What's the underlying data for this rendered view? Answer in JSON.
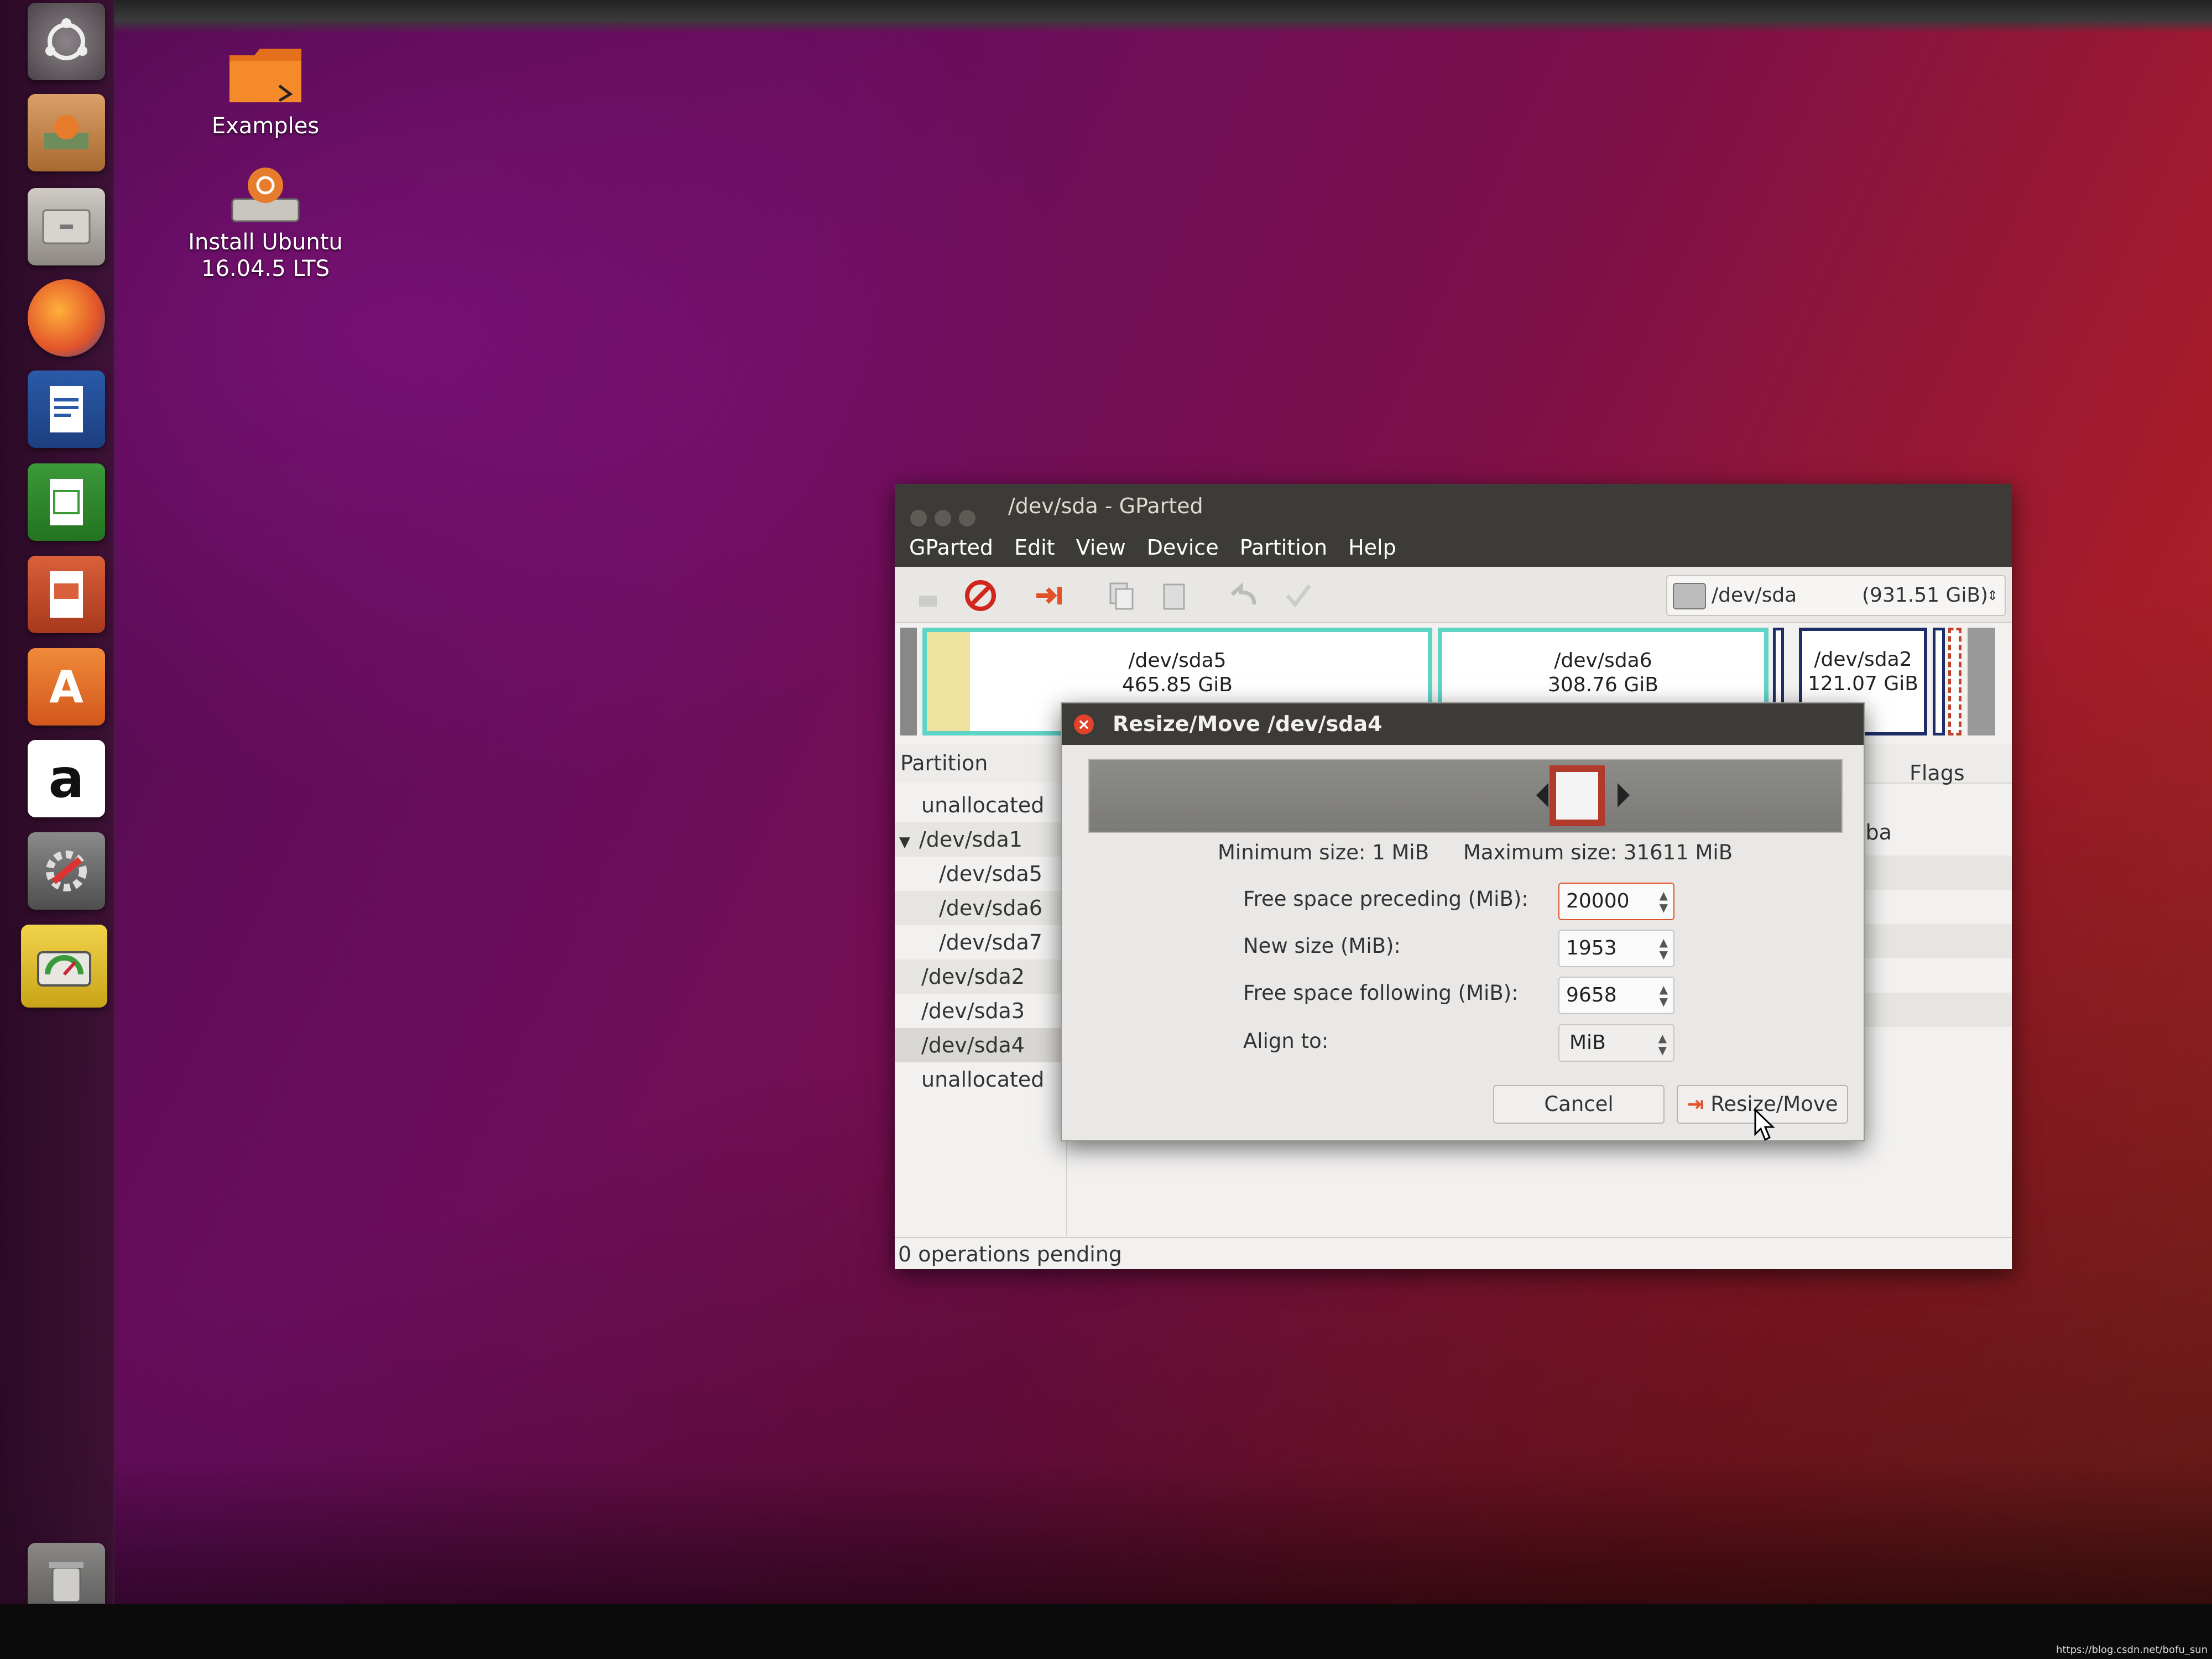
{
  "desktop": {
    "icons": [
      {
        "label": "Examples"
      },
      {
        "label_line1": "Install Ubuntu",
        "label_line2": "16.04.5 LTS"
      }
    ],
    "launcher": [
      {
        "name": "dash-home"
      },
      {
        "name": "install-ubuntu"
      },
      {
        "name": "files"
      },
      {
        "name": "firefox"
      },
      {
        "name": "libreoffice-writer"
      },
      {
        "name": "libreoffice-calc"
      },
      {
        "name": "libreoffice-impress"
      },
      {
        "name": "ubuntu-software"
      },
      {
        "name": "amazon",
        "glyph": "a"
      },
      {
        "name": "system-settings"
      },
      {
        "name": "gparted"
      },
      {
        "name": "trash"
      }
    ]
  },
  "window": {
    "title": "/dev/sda - GParted",
    "menu": [
      "GParted",
      "Edit",
      "View",
      "Device",
      "Partition",
      "Help"
    ],
    "device": {
      "name": "/dev/sda",
      "size": "(931.51 GiB)"
    },
    "partition_map": [
      {
        "name": "/dev/sda5",
        "size": "465.85 GiB"
      },
      {
        "name": "/dev/sda6",
        "size": "308.76 GiB"
      },
      {
        "name": "/dev/sda2",
        "size": "121.07 GiB"
      }
    ],
    "columns": {
      "partition": "Partition",
      "flags": "Flags"
    },
    "flags_partial": "lba",
    "partitions": [
      "unallocated",
      "/dev/sda1",
      "/dev/sda5",
      "/dev/sda6",
      "/dev/sda7",
      "/dev/sda2",
      "/dev/sda3",
      "/dev/sda4",
      "unallocated"
    ],
    "status": "0 operations pending"
  },
  "dialog": {
    "title": "Resize/Move /dev/sda4",
    "min_size": "Minimum size: 1 MiB",
    "max_size": "Maximum size: 31611 MiB",
    "fields": {
      "preceding_label": "Free space preceding (MiB):",
      "preceding_value": "20000",
      "new_size_label": "New size (MiB):",
      "new_size_value": "1953",
      "following_label": "Free space following (MiB):",
      "following_value": "9658",
      "align_label": "Align to:",
      "align_value": "MiB"
    },
    "cancel": "Cancel",
    "confirm": "Resize/Move"
  },
  "watermark": "https://blog.csdn.net/bofu_sun",
  "colors": {
    "accent": "#e0532a",
    "partition_border": "#5fd3c6",
    "dialog_block": "#b23a2c"
  }
}
